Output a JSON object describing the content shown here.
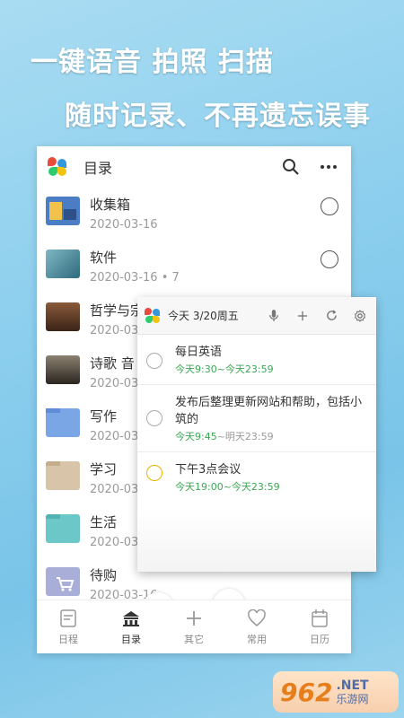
{
  "headline": {
    "line1": "一键语音 拍照 扫描",
    "line2": "随时记录、不再遗忘误事"
  },
  "topbar": {
    "title": "目录",
    "icons": [
      "logo-icon",
      "search-icon",
      "more-icon"
    ]
  },
  "folders": [
    {
      "name": "收集箱",
      "date": "2020-03-16",
      "thumb_color": "#4a7dc4"
    },
    {
      "name": "软件",
      "date": "2020-03-16",
      "extra": "• 7",
      "thumb_color": "#3b7a8a"
    },
    {
      "name": "哲学与宗",
      "date": "2020-03",
      "thumb_color": "#5a3a2a"
    },
    {
      "name": "诗歌 音",
      "date": "2020-03",
      "thumb_color": "#4a4438"
    },
    {
      "name": "写作",
      "date": "2020-03",
      "thumb_color": "#7aa6e6"
    },
    {
      "name": "学习",
      "date": "2020-03",
      "thumb_color": "#d8c4a8"
    },
    {
      "name": "生活",
      "date": "2020-03",
      "thumb_color": "#6cc8c8"
    },
    {
      "name": "待购",
      "date": "2020-03-16",
      "thumb_color": "#a8aed8"
    }
  ],
  "bottom_nav": [
    {
      "label": "日程",
      "icon": "schedule-icon"
    },
    {
      "label": "目录",
      "icon": "catalog-icon",
      "active": true
    },
    {
      "label": "其它",
      "icon": "plus-icon"
    },
    {
      "label": "常用",
      "icon": "heart-icon"
    },
    {
      "label": "日历",
      "icon": "calendar-icon"
    }
  ],
  "widget": {
    "title": "今天  3/20周五",
    "tasks": [
      {
        "name": "每日英语",
        "time_a": "今天9:30~今天23:59",
        "time_b": ""
      },
      {
        "name": "发布后整理更新网站和帮助，包括小筑的",
        "time_a": "今天9:45",
        "time_b": "~明天23:59"
      },
      {
        "name": "下午3点会议",
        "time_a": "今天19:00~今天23:59",
        "time_b": ""
      }
    ]
  },
  "watermark": {
    "number": "962",
    "net": ".NET",
    "cn": "乐游网"
  },
  "colors": {
    "background": "#8fd0ee",
    "accent_green": "#3aa853",
    "checkbox_yellow": "#e8b400",
    "watermark_orange": "#e67f1b"
  }
}
